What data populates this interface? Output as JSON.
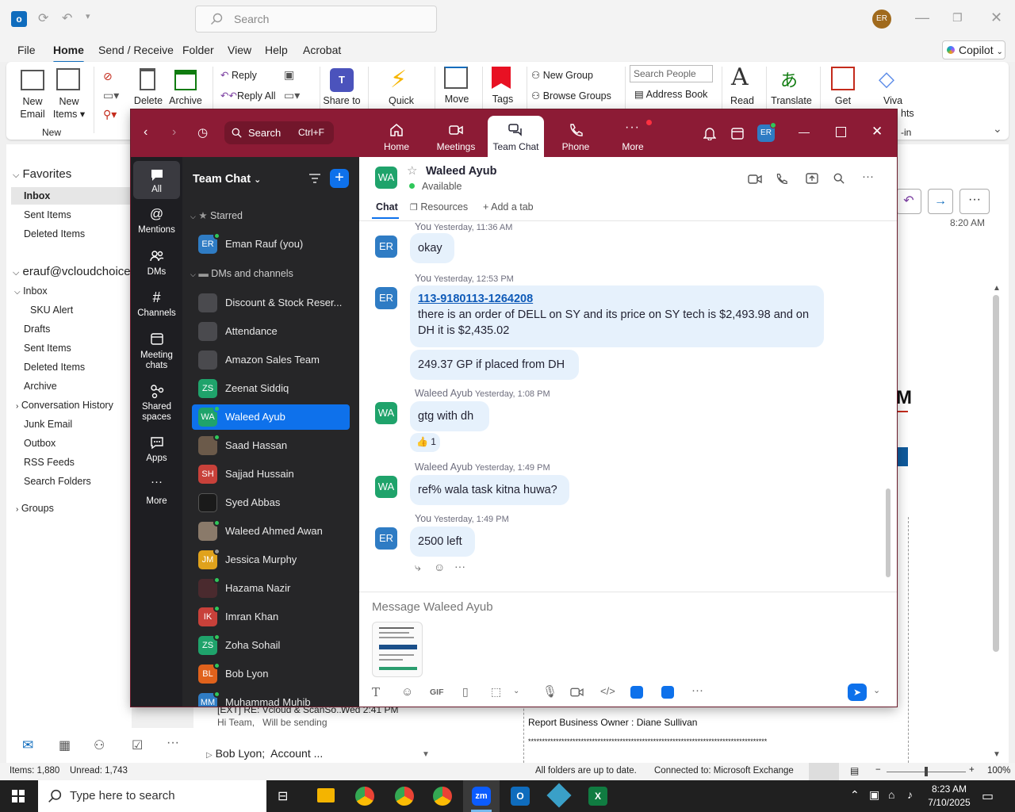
{
  "outlook": {
    "search_placeholder": "Search",
    "profile_initials": "ER",
    "tabs": [
      "File",
      "Home",
      "Send / Receive",
      "Folder",
      "View",
      "Help",
      "Acrobat"
    ],
    "copilot": "Copilot",
    "ribbon": {
      "new_email": [
        "New",
        "Email"
      ],
      "new_items": [
        "New",
        "Items"
      ],
      "group_new": "New",
      "delete": "Delete",
      "archive": "Archive",
      "reply": "Reply",
      "reply_all": "Reply All",
      "share_to": "Share to",
      "quick": "Quick",
      "move": "Move",
      "tags": "Tags",
      "new_group": "New Group",
      "browse_groups": "Browse Groups",
      "search_people": "Search People",
      "address_book": "Address Book",
      "read": "Read",
      "translate": "Translate",
      "get": "Get",
      "viva": "Viva",
      "hts": "hts",
      "in": "-in"
    },
    "folders": {
      "favorites": "Favorites",
      "fav_items": [
        "Inbox",
        "Sent Items",
        "Deleted Items"
      ],
      "account": "erauf@vcloudchoice",
      "inbox": "Inbox",
      "sku_alert": "SKU Alert",
      "items": [
        "Drafts",
        "Sent Items",
        "Deleted Items",
        "Archive",
        "Conversation History",
        "Junk Email",
        "Outbox",
        "RSS Feeds",
        "Search Folders"
      ],
      "groups": "Groups"
    },
    "message_list": {
      "subject": "[EXT] RE: Vcloud & ScanSo...",
      "time": "Wed 2:41 PM",
      "preview": "Hi Team,   Will be sending",
      "next_sender": "Bob Lyon;  Account ..."
    },
    "reading": {
      "time": "8:20 AM",
      "letter": "M",
      "owner": "Report Business Owner : Diane Sullivan",
      "stars": "**************************************************************************************"
    },
    "status": {
      "items": "Items: 1,880",
      "unread": "Unread: 1,743",
      "sync": "All folders are up to date.",
      "connected": "Connected to: Microsoft Exchange",
      "zoom": "100%"
    }
  },
  "taskbar": {
    "search": "Type here to search",
    "time": "8:23 AM",
    "date": "7/10/2025"
  },
  "zoom": {
    "search": "Search",
    "shortcut": "Ctrl+F",
    "tabs": [
      "Home",
      "Meetings",
      "Team Chat",
      "Phone",
      "More"
    ],
    "user_initials": "ER",
    "rail": [
      "All",
      "Mentions",
      "DMs",
      "Channels",
      "Meeting",
      "chats",
      "Shared",
      "spaces",
      "Apps",
      "More"
    ],
    "list": {
      "title": "Team Chat",
      "starred": "Starred",
      "me": {
        "initials": "ER",
        "name": "Eman Rauf (you)"
      },
      "dms_section": "DMs and channels",
      "channels": [
        "Discount & Stock Reser...",
        "Attendance",
        "Amazon Sales Team"
      ],
      "contacts": [
        {
          "initials": "ZS",
          "name": "Zeenat Siddiq"
        },
        {
          "initials": "WA",
          "name": "Waleed Ayub"
        },
        {
          "initials": "",
          "name": "Saad Hassan"
        },
        {
          "initials": "SH",
          "name": "Sajjad Hussain"
        },
        {
          "initials": "",
          "name": "Syed Abbas"
        },
        {
          "initials": "",
          "name": "Waleed Ahmed Awan"
        },
        {
          "initials": "JM",
          "name": "Jessica Murphy"
        },
        {
          "initials": "",
          "name": "Hazama Nazir"
        },
        {
          "initials": "IK",
          "name": "Imran Khan"
        },
        {
          "initials": "ZS",
          "name": "Zoha Sohail"
        },
        {
          "initials": "BL",
          "name": "Bob Lyon"
        },
        {
          "initials": "MM",
          "name": "Muhammad Muhib"
        }
      ]
    },
    "chat": {
      "contact_initials": "WA",
      "contact_name": "Waleed Ayub",
      "presence": "Available",
      "tabs": [
        "Chat",
        "Resources",
        "Add a tab"
      ],
      "messages": [
        {
          "initials": "ER",
          "sender": "You",
          "time": "Yesterday, 11:36 AM",
          "text": "okay"
        },
        {
          "initials": "ER",
          "sender": "You",
          "time": "Yesterday, 12:53 PM",
          "link": "113-9180113-1264208",
          "text": "there is an order of DELL on SY and its price on SY tech is $2,493.98 and on DH it is $2,435.02",
          "followup": "249.37 GP if placed from DH"
        },
        {
          "initials": "WA",
          "sender": "Waleed Ayub",
          "time": "Yesterday, 1:08 PM",
          "text": "gtg with dh",
          "reaction_count": "1"
        },
        {
          "initials": "WA",
          "sender": "Waleed Ayub",
          "time": "Yesterday, 1:49 PM",
          "text": "ref% wala task kitna huwa?"
        },
        {
          "initials": "ER",
          "sender": "You",
          "time": "Yesterday, 1:49 PM",
          "text": "2500 left"
        }
      ],
      "composer_placeholder": "Message Waleed Ayub",
      "gif": "GIF"
    }
  }
}
